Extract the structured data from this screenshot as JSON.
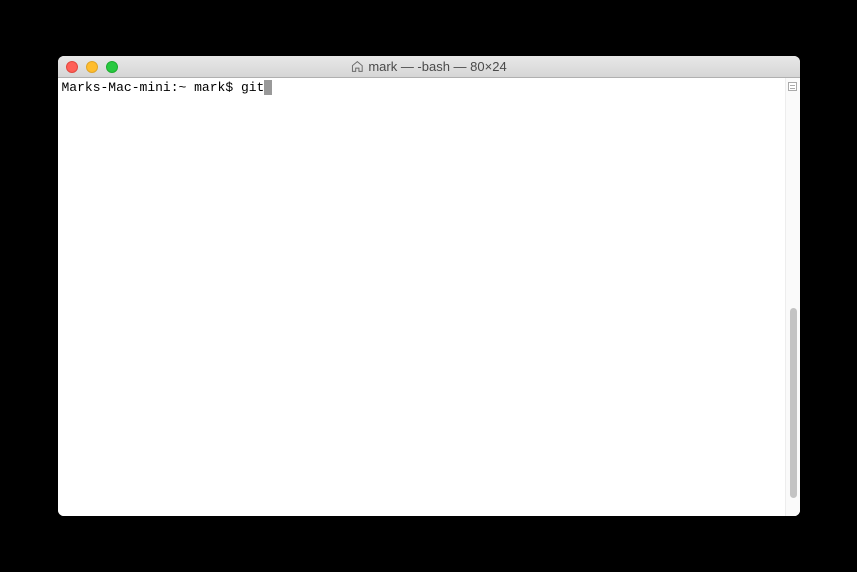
{
  "window": {
    "title": "mark — -bash — 80×24"
  },
  "terminal": {
    "prompt": "Marks-Mac-mini:~ mark$ ",
    "command": "git"
  }
}
